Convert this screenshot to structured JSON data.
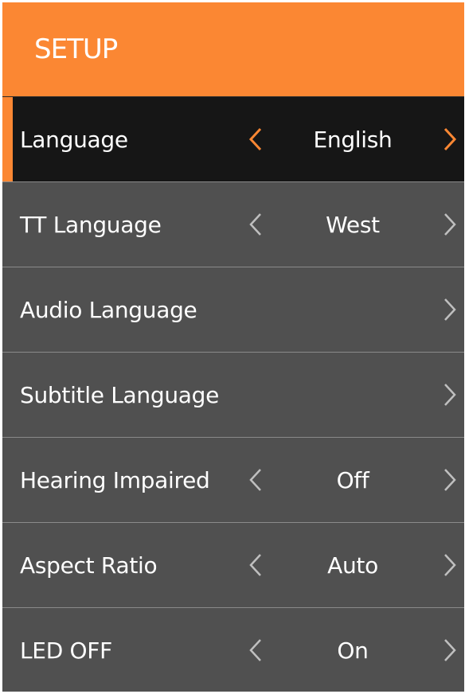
{
  "header": {
    "title": "SETUP"
  },
  "colors": {
    "accent": "#fb8733",
    "panel_bg": "#505050",
    "selected_bg": "#161616",
    "text": "#ffffff",
    "arrow_inactive": "#bfbfbf"
  },
  "menu": {
    "items": [
      {
        "label": "Language",
        "value": "English",
        "has_left_arrow": true,
        "has_right_arrow": true,
        "selected": true
      },
      {
        "label": "TT Language",
        "value": "West",
        "has_left_arrow": true,
        "has_right_arrow": true,
        "selected": false
      },
      {
        "label": "Audio Language",
        "value": "",
        "has_left_arrow": false,
        "has_right_arrow": true,
        "selected": false
      },
      {
        "label": "Subtitle Language",
        "value": "",
        "has_left_arrow": false,
        "has_right_arrow": true,
        "selected": false
      },
      {
        "label": "Hearing Impaired",
        "value": "Off",
        "has_left_arrow": true,
        "has_right_arrow": true,
        "selected": false
      },
      {
        "label": "Aspect Ratio",
        "value": "Auto",
        "has_left_arrow": true,
        "has_right_arrow": true,
        "selected": false
      },
      {
        "label": "LED OFF",
        "value": "On",
        "has_left_arrow": true,
        "has_right_arrow": true,
        "selected": false
      }
    ]
  }
}
